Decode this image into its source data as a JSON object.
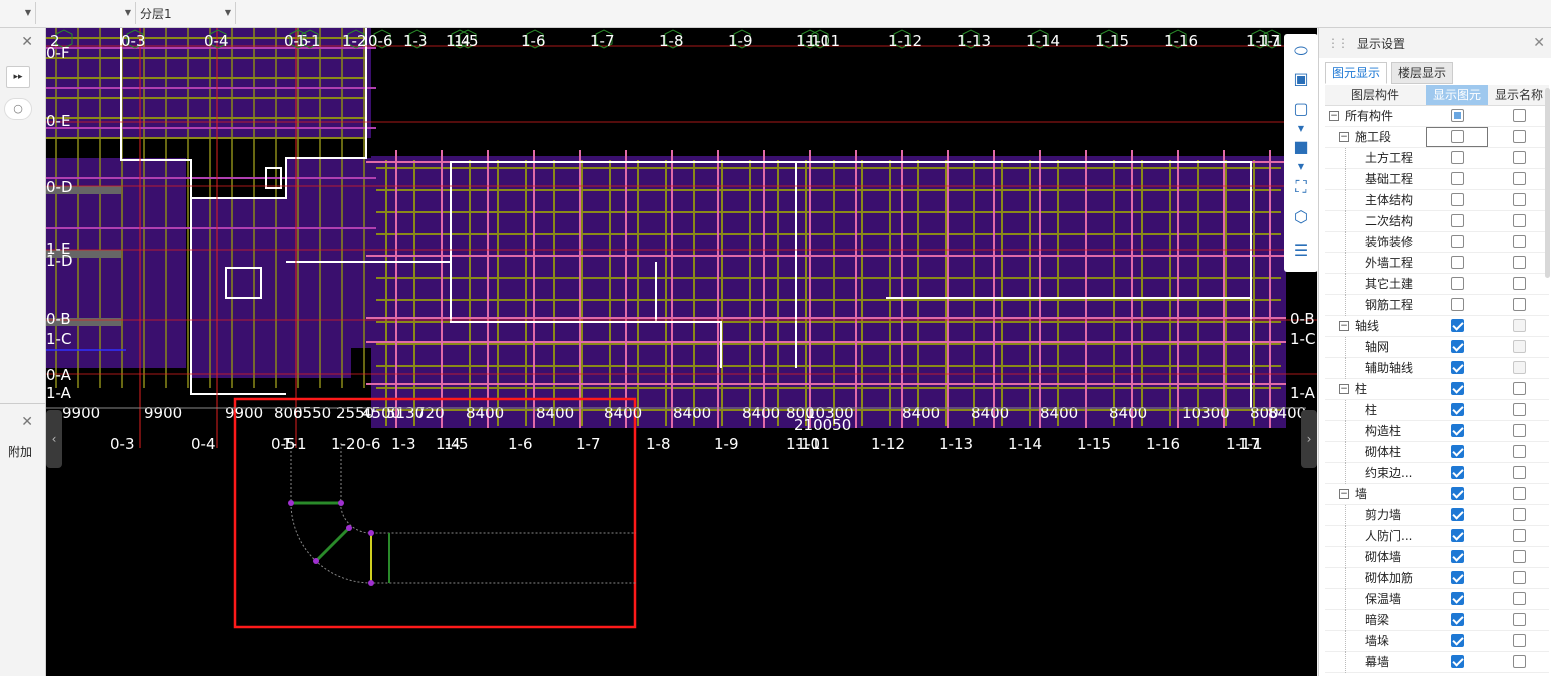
{
  "toolbar": {
    "dropdown1": "",
    "dropdown2": "",
    "layer_select": "分层1"
  },
  "left_panel": {
    "expand_button": "▸▸",
    "append_label": "附加"
  },
  "canvas": {
    "axis_top_labels": [
      "2",
      "0-3",
      "0-4",
      "0-5",
      "1-1",
      "1-2",
      "0-6",
      "1-3",
      "1-4",
      "1-5",
      "1-6",
      "1-7",
      "1-8",
      "1-9",
      "1-10",
      "1-11",
      "1-12",
      "1-13",
      "1-14",
      "1-15",
      "1-16",
      "1-17",
      "1-1"
    ],
    "axis_bottom_labels": [
      "0-3",
      "0-4",
      "0-5",
      "1-1",
      "1-2",
      "0-6",
      "1-3",
      "1-4",
      "1-5",
      "1-6",
      "1-7",
      "1-8",
      "1-9",
      "1-10",
      "1-11",
      "1-12",
      "1-13",
      "1-14",
      "1-15",
      "1-16",
      "1-17",
      "1-1"
    ],
    "axis_left_labels": [
      "0-F",
      "0-E",
      "0-D",
      "1-E",
      "1-D",
      "0-B",
      "1-C",
      "0-A",
      "1-A"
    ],
    "axis_right_labels": [
      "0-B",
      "1-C",
      "1-A"
    ],
    "dimension_labels": [
      "9900",
      "9900",
      "9900",
      "800",
      "6550",
      "2550",
      "4500",
      "5130",
      "720",
      "8400",
      "8400",
      "8400",
      "8400",
      "8400",
      "800",
      "10300",
      "8400",
      "8400",
      "8400",
      "8400",
      "10300",
      "800",
      "8400"
    ],
    "total_dimension": "210050"
  },
  "display_panel": {
    "title": "显示设置",
    "tabs": [
      "图元显示",
      "楼层显示"
    ],
    "columns": [
      "图层构件",
      "显示图元",
      "显示名称"
    ],
    "rows": [
      {
        "name": "所有构件",
        "level": 0,
        "expander": "−",
        "show": "partial",
        "label": "off"
      },
      {
        "name": "施工段",
        "level": 1,
        "expander": "−",
        "show": "off",
        "label": "off",
        "focus": true
      },
      {
        "name": "土方工程",
        "level": 2,
        "show": "off",
        "label": "off"
      },
      {
        "name": "基础工程",
        "level": 2,
        "show": "off",
        "label": "off"
      },
      {
        "name": "主体结构",
        "level": 2,
        "show": "off",
        "label": "off"
      },
      {
        "name": "二次结构",
        "level": 2,
        "show": "off",
        "label": "off"
      },
      {
        "name": "装饰装修",
        "level": 2,
        "show": "off",
        "label": "off"
      },
      {
        "name": "外墙工程",
        "level": 2,
        "show": "off",
        "label": "off"
      },
      {
        "name": "其它土建",
        "level": 2,
        "show": "off",
        "label": "off"
      },
      {
        "name": "钢筋工程",
        "level": 2,
        "show": "off",
        "label": "off"
      },
      {
        "name": "轴线",
        "level": 1,
        "expander": "−",
        "show": "on",
        "label": "disabled"
      },
      {
        "name": "轴网",
        "level": 2,
        "show": "on",
        "label": "disabled"
      },
      {
        "name": "辅助轴线",
        "level": 2,
        "show": "on",
        "label": "disabled"
      },
      {
        "name": "柱",
        "level": 1,
        "expander": "−",
        "show": "on",
        "label": "off"
      },
      {
        "name": "柱",
        "level": 2,
        "show": "on",
        "label": "off"
      },
      {
        "name": "构造柱",
        "level": 2,
        "show": "on",
        "label": "off"
      },
      {
        "name": "砌体柱",
        "level": 2,
        "show": "on",
        "label": "off"
      },
      {
        "name": "约束边...",
        "level": 2,
        "show": "on",
        "label": "off"
      },
      {
        "name": "墙",
        "level": 1,
        "expander": "−",
        "show": "on",
        "label": "off"
      },
      {
        "name": "剪力墙",
        "level": 2,
        "show": "on",
        "label": "off"
      },
      {
        "name": "人防门...",
        "level": 2,
        "show": "on",
        "label": "off"
      },
      {
        "name": "砌体墙",
        "level": 2,
        "show": "on",
        "label": "off"
      },
      {
        "name": "砌体加筋",
        "level": 2,
        "show": "on",
        "label": "off"
      },
      {
        "name": "保温墙",
        "level": 2,
        "show": "on",
        "label": "off"
      },
      {
        "name": "暗梁",
        "level": 2,
        "show": "on",
        "label": "off"
      },
      {
        "name": "墙垛",
        "level": 2,
        "show": "on",
        "label": "off"
      },
      {
        "name": "幕墙",
        "level": 2,
        "show": "on",
        "label": "off"
      }
    ]
  },
  "colors": {
    "canvas_bg": "#000000",
    "slab_fill": "#3a0f6e",
    "beam_olive": "#8a8a18",
    "beam_pink": "#e06aa8",
    "axis_red": "#e02020",
    "wall_white": "#ffffff",
    "accent_blue": "#1e78d4"
  }
}
